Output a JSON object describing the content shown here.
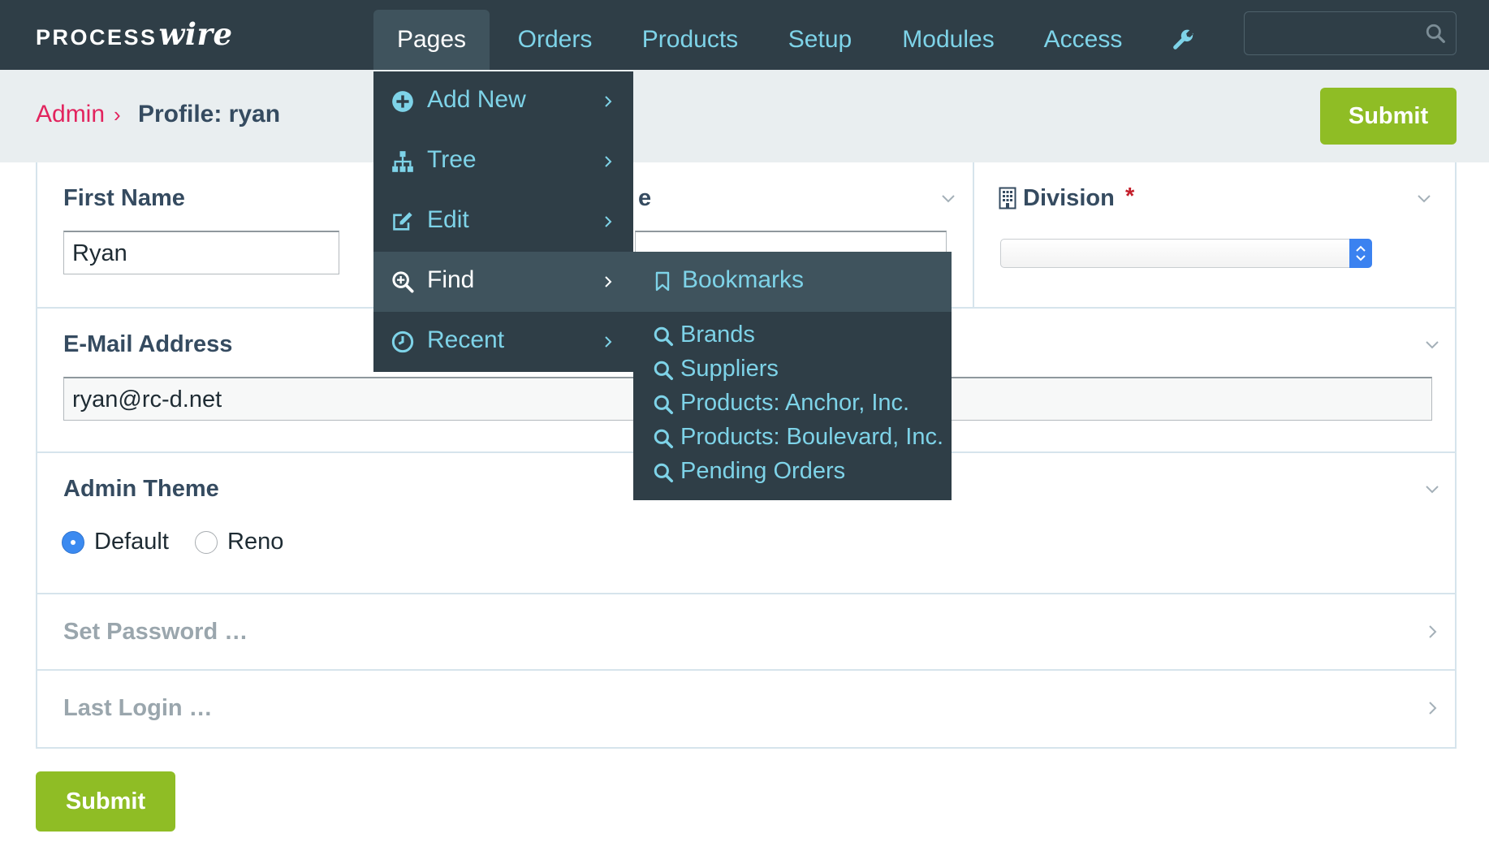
{
  "app": {
    "logo_part1": "PROCESS",
    "logo_part2": "wire"
  },
  "nav": {
    "items": [
      "Pages",
      "Orders",
      "Products",
      "Setup",
      "Modules",
      "Access"
    ],
    "wrench_icon": "wrench-icon",
    "search": {
      "placeholder": "",
      "icon": "search-icon"
    }
  },
  "breadcrumb": {
    "root": "Admin",
    "separator": "›",
    "current": "Profile: ryan"
  },
  "buttons": {
    "submit_top": "Submit",
    "submit_bottom": "Submit"
  },
  "form": {
    "first_name": {
      "label": "First Name",
      "value": "Ryan"
    },
    "last_name": {
      "label_visible_fragment": "e",
      "value": ""
    },
    "division": {
      "label": "Division",
      "required_mark": "*",
      "icon": "building-icon",
      "value": ""
    },
    "email": {
      "label": "E-Mail Address",
      "value": "ryan@rc-d.net"
    },
    "admin_theme": {
      "label": "Admin Theme",
      "options": [
        {
          "label": "Default",
          "selected": true
        },
        {
          "label": "Reno",
          "selected": false
        }
      ]
    },
    "set_password": {
      "label": "Set Password …"
    },
    "last_login": {
      "label": "Last Login …"
    }
  },
  "pages_menu": {
    "items": [
      {
        "label": "Add New",
        "icon": "plus-circle-icon"
      },
      {
        "label": "Tree",
        "icon": "sitemap-icon"
      },
      {
        "label": "Edit",
        "icon": "edit-icon"
      },
      {
        "label": "Find",
        "icon": "search-plus-icon",
        "hover": true
      },
      {
        "label": "Recent",
        "icon": "clock-icon"
      }
    ]
  },
  "find_submenu": {
    "header": {
      "label": "Bookmarks",
      "icon": "bookmark-icon"
    },
    "items": [
      "Brands",
      "Suppliers",
      "Products: Anchor, Inc.",
      "Products: Boulevard, Inc.",
      "Pending Orders"
    ]
  },
  "colors": {
    "topbar": "#2f3e47",
    "menu_hover": "#3f535d",
    "nav_link": "#7ed3e8",
    "breadcrumb_link": "#e2245e",
    "submit_button": "#8fbd25",
    "radio_selected": "#3b8af0"
  }
}
